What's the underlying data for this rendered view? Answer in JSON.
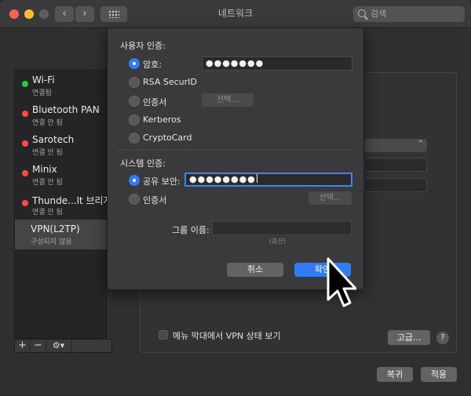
{
  "window": {
    "title": "네트워크"
  },
  "search": {
    "placeholder": "검색"
  },
  "sidebar": {
    "services": [
      {
        "name": "Wi-Fi",
        "status": "연결됨",
        "color": "#29c940"
      },
      {
        "name": "Bluetooth PAN",
        "status": "연결 안 됨",
        "color": "#ff4a46"
      },
      {
        "name": "Sarotech",
        "status": "연결 안 됨",
        "color": "#ff4a46"
      },
      {
        "name": "Minix",
        "status": "연결 안 됨",
        "color": "#ff4a46"
      },
      {
        "name": "Thunde...lt 브리지",
        "status": "연결 안 됨",
        "color": "#ff4a46"
      },
      {
        "name": "VPN(L2TP)",
        "status": "구성되지 않음",
        "selected": true
      }
    ],
    "toolbar": {
      "add": "+",
      "remove": "−",
      "gear": "⚙▾"
    }
  },
  "sheet": {
    "user_auth": {
      "heading": "사용자 인증:",
      "options": [
        {
          "label": "암호:",
          "selected": true,
          "value": "●●●●●●●"
        },
        {
          "label": "RSA SecurID"
        },
        {
          "label": "인증서",
          "button": "선택..."
        },
        {
          "label": "Kerberos"
        },
        {
          "label": "CryptoCard"
        }
      ]
    },
    "system_auth": {
      "heading": "시스템 인증:",
      "options": [
        {
          "label": "공유 보안:",
          "selected": true,
          "value": "●●●●●●●●"
        },
        {
          "label": "인증서",
          "button": "선택..."
        }
      ]
    },
    "group": {
      "label": "그룹 이름:",
      "hint": "(옵션)"
    },
    "buttons": {
      "cancel": "취소",
      "ok": "확인"
    }
  },
  "main": {
    "show_vpn_status": "메뉴 막대에서 VPN 상태 보기",
    "advanced": "고급...",
    "help": "?",
    "revert": "복귀",
    "apply": "적용"
  },
  "accent": "#2f7cf6"
}
